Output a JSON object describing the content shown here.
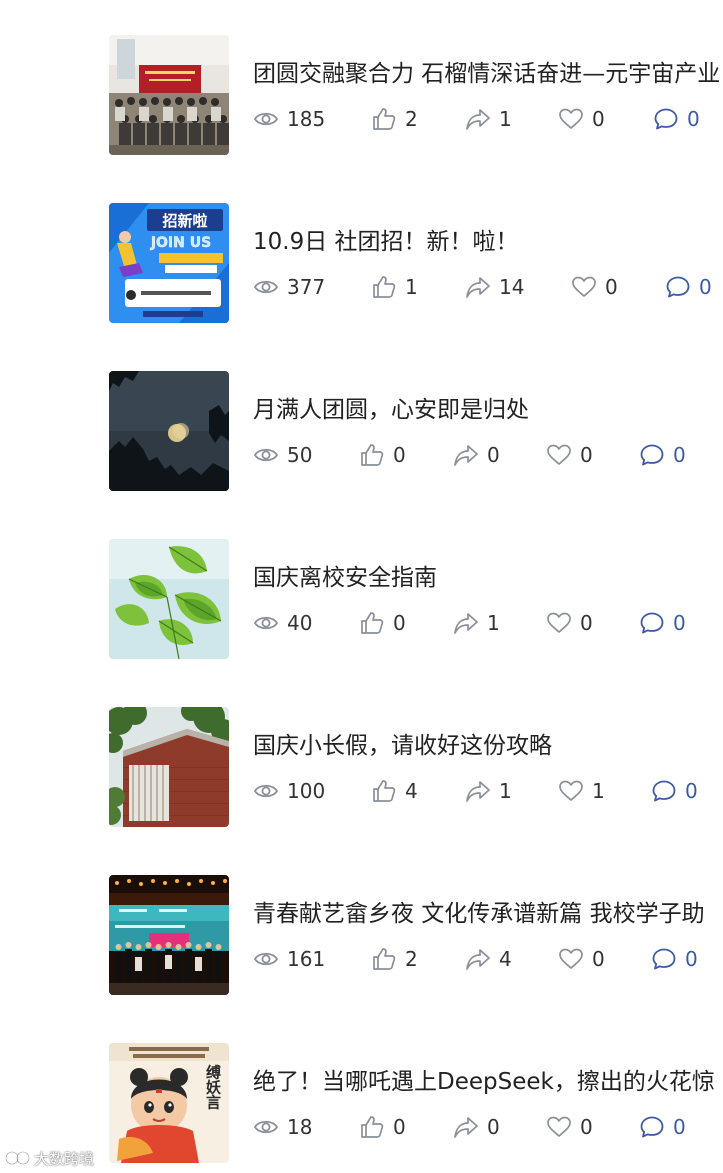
{
  "watermark": {
    "text": "大数跨境"
  },
  "articles": [
    {
      "title": "团圆交融聚合力 石榴情深话奋进—元宇宙产业",
      "thumb": "group-photo",
      "views": "185",
      "likes": "2",
      "shares": "1",
      "favorites": "0",
      "comments": "0"
    },
    {
      "title": "10.9日 社团招！新！啦！",
      "thumb": "recruit-poster",
      "thumb_text": [
        "招新啦",
        "JOIN US"
      ],
      "views": "377",
      "likes": "1",
      "shares": "14",
      "favorites": "0",
      "comments": "0"
    },
    {
      "title": "月满人团圆，心安即是归处",
      "thumb": "moon-night",
      "views": "50",
      "likes": "0",
      "shares": "0",
      "favorites": "0",
      "comments": "0"
    },
    {
      "title": "国庆离校安全指南",
      "thumb": "green-leaves",
      "views": "40",
      "likes": "0",
      "shares": "1",
      "favorites": "0",
      "comments": "0"
    },
    {
      "title": "国庆小长假，请收好这份攻略",
      "thumb": "campus-building",
      "views": "100",
      "likes": "4",
      "shares": "1",
      "favorites": "1",
      "comments": "0"
    },
    {
      "title": "青春献艺畲乡夜  文化传承谱新篇 我校学子助",
      "thumb": "stage-performance",
      "views": "161",
      "likes": "2",
      "shares": "4",
      "favorites": "0",
      "comments": "0"
    },
    {
      "title": "绝了！当哪吒遇上DeepSeek，擦出的火花惊",
      "thumb": "nezha-cartoon",
      "thumb_text": [
        "缚妖言"
      ],
      "views": "18",
      "likes": "0",
      "shares": "0",
      "favorites": "0",
      "comments": "0"
    }
  ],
  "colors": {
    "icon_gray": "#8a8f99",
    "comment_blue": "#3c5aa6",
    "title_text": "#222222"
  },
  "icons": [
    "eye-icon",
    "thumbs-up-icon",
    "share-icon",
    "heart-icon",
    "comment-icon"
  ]
}
